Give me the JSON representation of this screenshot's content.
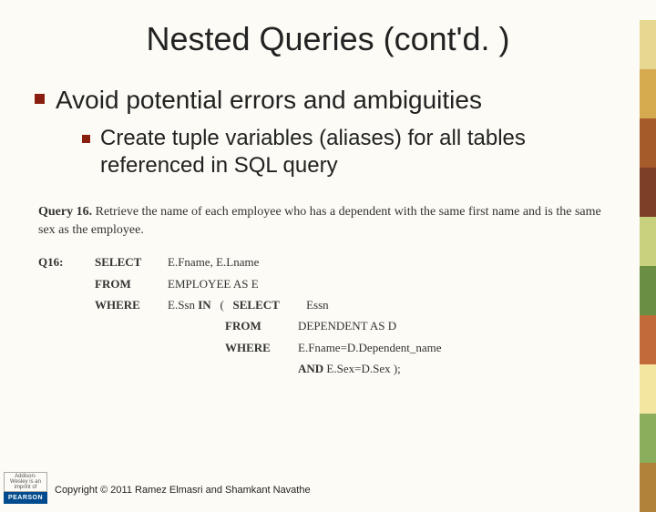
{
  "title": "Nested Queries (cont'd. )",
  "bullets": {
    "level1": "Avoid potential errors and ambiguities",
    "level2": "Create tuple variables (aliases) for all tables referenced in SQL query"
  },
  "query": {
    "heading_bold": "Query 16.",
    "heading_rest": "Retrieve the name of each employee who has a dependent with the same first name and is the same sex as the employee.",
    "label": "Q16:",
    "rows": [
      {
        "kw": "SELECT",
        "val": "E.Fname, E.Lname"
      },
      {
        "kw": "FROM",
        "val": "EMPLOYEE AS E"
      },
      {
        "kw": "WHERE",
        "val": "E.Ssn IN   (   SELECT"
      }
    ],
    "inner": [
      {
        "kw": "",
        "val": "Essn",
        "first": true
      },
      {
        "kw": "FROM",
        "val": "DEPENDENT AS D"
      },
      {
        "kw": "WHERE",
        "val": "E.Fname=D.Dependent_name"
      },
      {
        "kw": "",
        "val": "AND E.Sex=D.Sex );"
      }
    ]
  },
  "footer": {
    "logo_top": "Addison-Wesley is an imprint of",
    "logo_bottom": "PEARSON",
    "copyright": "Copyright © 2011 Ramez Elmasri and Shamkant Navathe"
  }
}
